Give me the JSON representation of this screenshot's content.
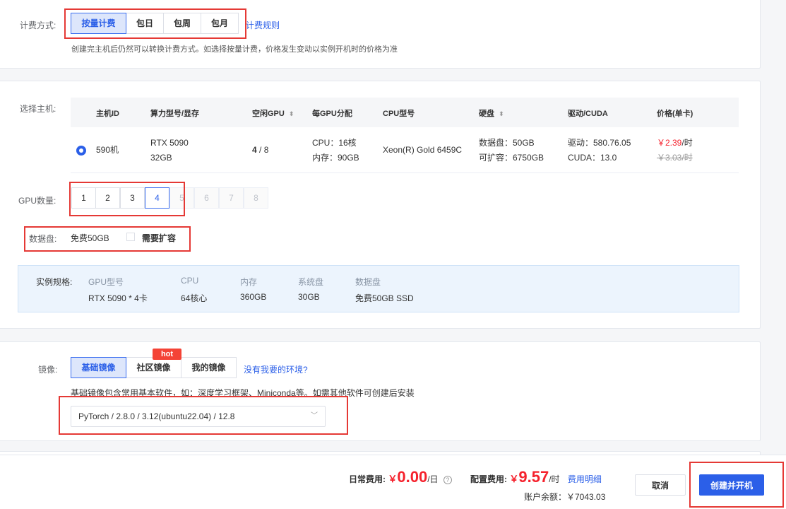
{
  "billing": {
    "label": "计费方式:",
    "options": [
      "按量计费",
      "包日",
      "包周",
      "包月"
    ],
    "rules_link": "计费规则",
    "hint": "创建完主机后仍然可以转换计费方式。如选择按量计费，价格发生变动以实例开机时的价格为准"
  },
  "host": {
    "label": "选择主机:",
    "headers": [
      "主机ID",
      "算力型号/显存",
      "空闲GPU",
      "每GPU分配",
      "CPU型号",
      "硬盘",
      "驱动/CUDA",
      "价格(单卡)"
    ],
    "sort_icon": "sort-icon",
    "row": {
      "id": "590机",
      "gpu_model": "RTX 5090",
      "gpu_mem": "32GB",
      "free_gpu": "4",
      "total_gpu": "/ 8",
      "cpu_alloc": "CPU：16核",
      "mem_alloc": "内存：90GB",
      "cpu_model": "Xeon(R) Gold 6459C",
      "disk_data": "数据盘：50GB",
      "disk_expand": "可扩容：6750GB",
      "driver": "驱动：580.76.05",
      "cuda": "CUDA：13.0",
      "price": "￥2.39",
      "price_unit": "/时",
      "price_old": "￥3.03/时"
    }
  },
  "gpu_count": {
    "label": "GPU数量:",
    "options": [
      "1",
      "2",
      "3",
      "4",
      "5",
      "6",
      "7",
      "8"
    ],
    "selected": "4"
  },
  "data_disk": {
    "label": "数据盘:",
    "value": "免费50GB",
    "expand_label": "需要扩容"
  },
  "spec": {
    "label": "实例规格:",
    "cols": [
      {
        "h": "GPU型号",
        "v": "RTX 5090 * 4卡"
      },
      {
        "h": "CPU",
        "v": "64核心"
      },
      {
        "h": "内存",
        "v": "360GB"
      },
      {
        "h": "系统盘",
        "v": "30GB"
      },
      {
        "h": "数据盘",
        "v": "免费50GB SSD"
      }
    ]
  },
  "image": {
    "label": "镜像:",
    "tabs": [
      "基础镜像",
      "社区镜像",
      "我的镜像"
    ],
    "hot_badge": "hot",
    "missing_link": "没有我要的环境?",
    "hint": "基础镜像包含常用基本软件，如：深度学习框架、Miniconda等。如需其他软件可创建后安装",
    "selected_value": "PyTorch / 2.8.0 / 3.12(ubuntu22.04) / 12.8"
  },
  "footer": {
    "daily_label": "日常费用:",
    "daily_yen": "￥",
    "daily_value": "0.00",
    "daily_unit": "/日",
    "config_label": "配置费用:",
    "config_yen": "￥",
    "config_value": "9.57",
    "config_unit": "/时",
    "detail_link": "费用明细",
    "balance": "账户余额：￥7043.03",
    "cancel": "取消",
    "create": "创建并开机"
  },
  "colors": {
    "accent": "#2b5fe8",
    "price_red": "#f5222d",
    "highlight_box": "#e53935"
  }
}
